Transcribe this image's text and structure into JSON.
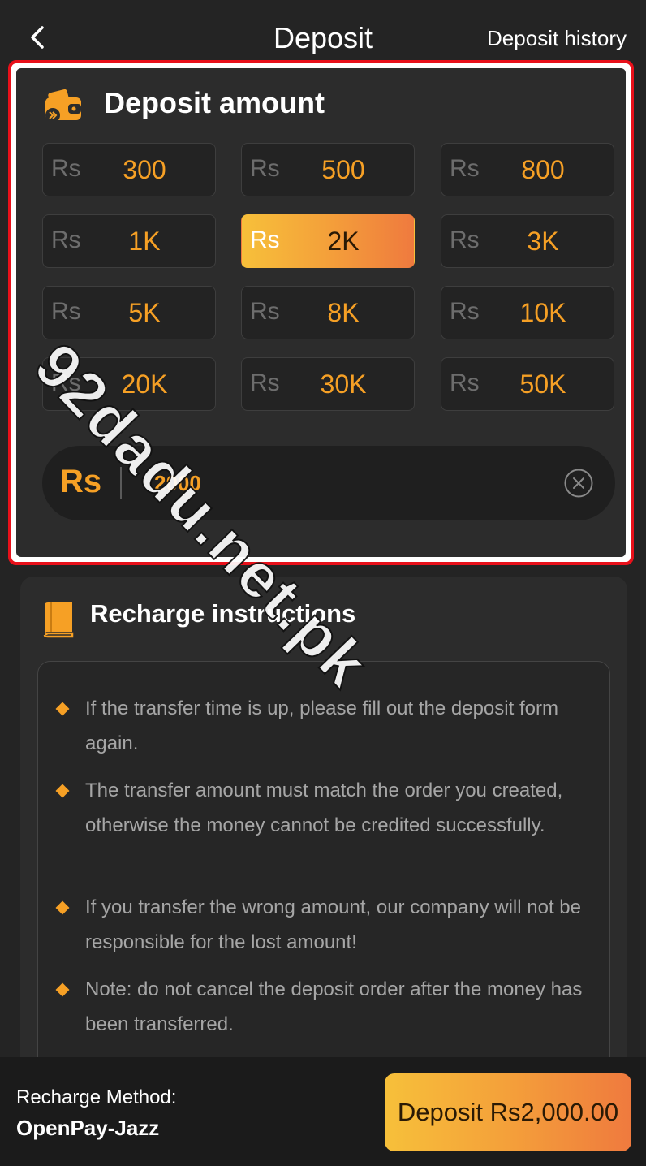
{
  "header": {
    "title": "Deposit",
    "history_label": "Deposit history"
  },
  "amount_panel": {
    "title": "Deposit amount",
    "currency": "Rs",
    "options": [
      {
        "value": "300",
        "selected": false
      },
      {
        "value": "500",
        "selected": false
      },
      {
        "value": "800",
        "selected": false
      },
      {
        "value": "1K",
        "selected": false
      },
      {
        "value": "2K",
        "selected": true
      },
      {
        "value": "3K",
        "selected": false
      },
      {
        "value": "5K",
        "selected": false
      },
      {
        "value": "8K",
        "selected": false
      },
      {
        "value": "10K",
        "selected": false
      },
      {
        "value": "20K",
        "selected": false
      },
      {
        "value": "30K",
        "selected": false
      },
      {
        "value": "50K",
        "selected": false
      }
    ],
    "input_currency": "Rs",
    "input_value": "2000"
  },
  "instructions": {
    "title": "Recharge instructions",
    "items": [
      "If the transfer time is up, please fill out the deposit form again.",
      "The transfer amount must match the order you created, otherwise the money cannot be credited successfully.",
      "If you transfer the wrong amount, our company will not be responsible for the lost amount!",
      "Note: do not cancel the deposit order after the money has been transferred."
    ]
  },
  "bottom_bar": {
    "method_label": "Recharge Method:",
    "method_value": "OpenPay-Jazz",
    "deposit_button": "Deposit Rs2,000.00"
  },
  "watermark": "92dadu.net.pk",
  "colors": {
    "accent": "#f6a025",
    "highlight_border": "#e8101a",
    "background": "#242424",
    "card": "#2c2c2c"
  },
  "icons": {
    "back": "chevron-left-icon",
    "wallet": "wallet-icon",
    "clear": "clear-circle-icon",
    "book": "book-icon"
  }
}
